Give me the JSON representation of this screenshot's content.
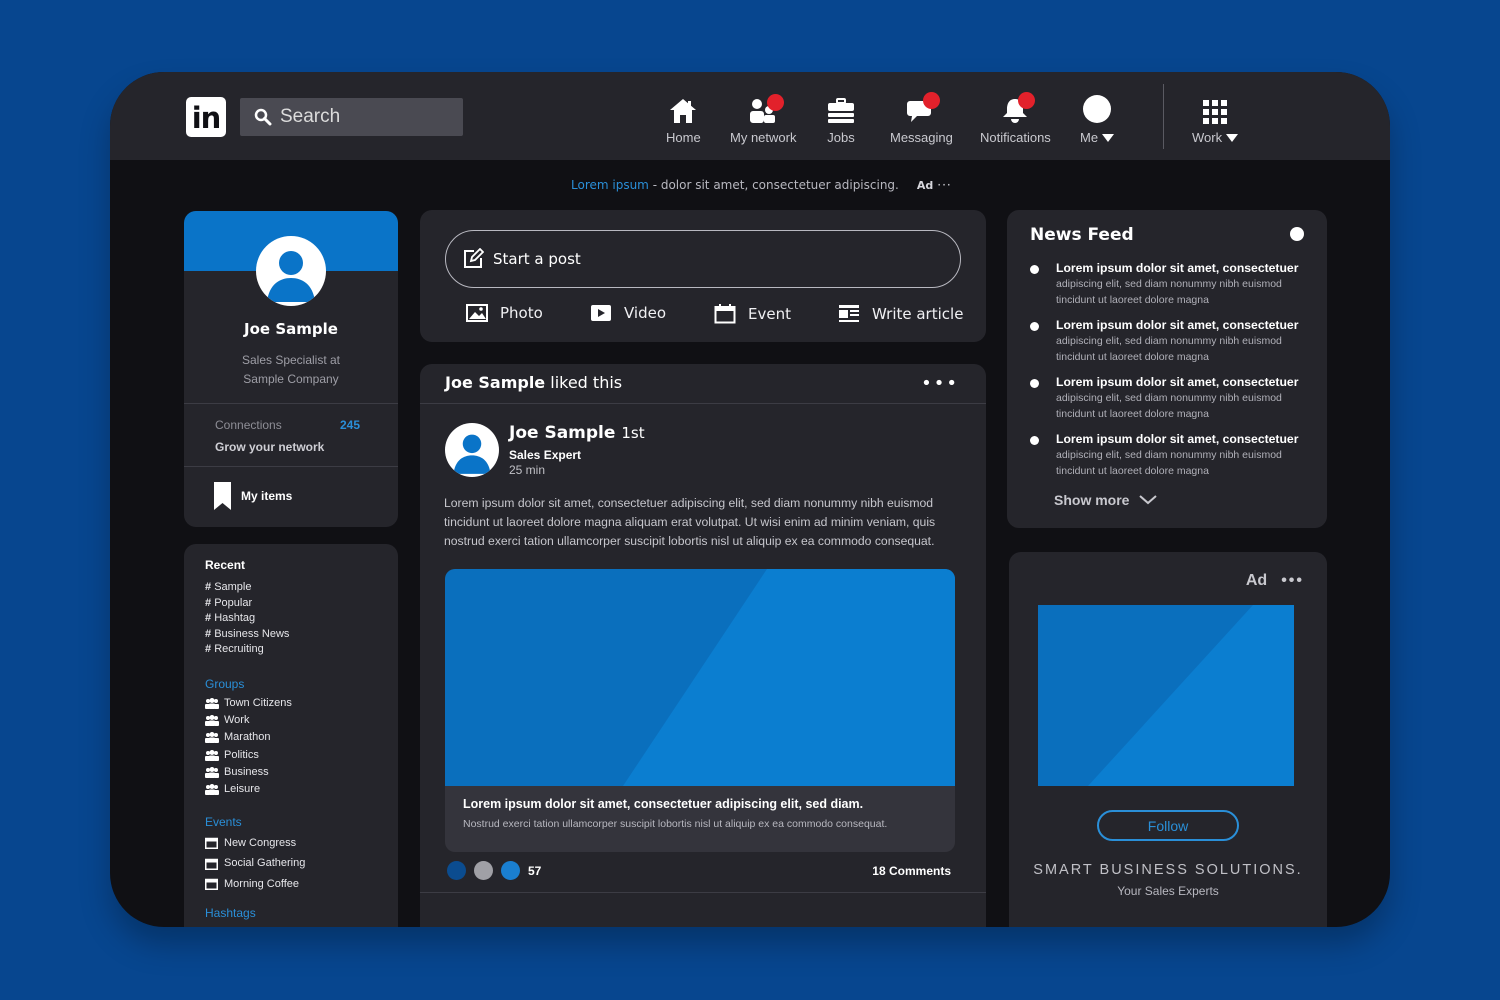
{
  "colors": {
    "accent": "#2a8fd8",
    "brand_blue": "#0a74c8",
    "notification": "#e2212b",
    "background": "#07468f",
    "panel": "#25252b"
  },
  "nav": {
    "logo": "in",
    "search_placeholder": "Search",
    "items": [
      {
        "label": "Home",
        "icon": "home-icon"
      },
      {
        "label": "My network",
        "icon": "network-icon"
      },
      {
        "label": "Jobs",
        "icon": "jobs-icon"
      },
      {
        "label": "Messaging",
        "icon": "messaging-icon"
      },
      {
        "label": "Notifications",
        "icon": "bell-icon"
      },
      {
        "label": "Me",
        "icon": "avatar-icon"
      },
      {
        "label": "Work",
        "icon": "grid-icon"
      }
    ]
  },
  "adbar": {
    "link": "Lorem ipsum",
    "text": " - dolor sit amet, consectetuer adipiscing.",
    "ad": "Ad",
    "more": "···"
  },
  "profile": {
    "name": "Joe Sample",
    "title_line1": "Sales Specialist at",
    "title_line2": "Sample Company",
    "connections_label": "Connections",
    "connections_count": "245",
    "grow": "Grow your network",
    "my_items": "My items"
  },
  "recent": {
    "heading": "Recent",
    "tags": [
      "Sample",
      "Popular",
      "Hashtag",
      "Business News",
      "Recruiting"
    ],
    "groups_heading": "Groups",
    "groups": [
      "Town Citizens",
      "Work",
      "Marathon",
      "Politics",
      "Business",
      "Leisure"
    ],
    "events_heading": "Events",
    "events": [
      "New Congress",
      "Social Gathering",
      "Morning Coffee"
    ],
    "hashtags_heading": "Hashtags"
  },
  "composer": {
    "start": "Start a post",
    "actions": [
      {
        "label": "Photo",
        "icon": "photo-icon"
      },
      {
        "label": "Video",
        "icon": "video-icon"
      },
      {
        "label": "Event",
        "icon": "calendar-icon"
      },
      {
        "label": "Write article",
        "icon": "article-icon"
      }
    ]
  },
  "post": {
    "liked_name": "Joe Sample",
    "liked_text": " liked this",
    "more": "•••",
    "author": "Joe Sample",
    "degree": "1st",
    "role": "Sales Expert",
    "time": "25 min",
    "body": "Lorem ipsum dolor sit amet, consectetuer adipiscing elit, sed diam nonummy nibh euismod tincidunt ut laoreet dolore magna aliquam erat volutpat. Ut wisi enim ad minim veniam, quis nostrud exerci tation ullamcorper suscipit lobortis nisl ut aliquip ex ea commodo consequat.",
    "caption_title": "Lorem ipsum dolor sit amet, consectetuer adipiscing elit, sed diam.",
    "caption_sub": "Nostrud exerci tation ullamcorper suscipit lobortis nisl ut aliquip ex ea commodo consequat.",
    "reactions": "57",
    "reaction_colors": [
      "#0b4c8f",
      "#a0a0a6",
      "#1a7fd0"
    ],
    "comments": "18 Comments"
  },
  "news": {
    "heading": "News Feed",
    "items": [
      {
        "title": "Lorem ipsum dolor sit amet, consectetuer",
        "sub": "adipiscing elit, sed diam nonummy nibh euismod tincidunt ut laoreet dolore magna"
      },
      {
        "title": "Lorem ipsum dolor sit amet, consectetuer",
        "sub": "adipiscing elit, sed diam nonummy nibh euismod tincidunt ut laoreet dolore magna"
      },
      {
        "title": "Lorem ipsum dolor sit amet, consectetuer",
        "sub": "adipiscing elit, sed diam nonummy nibh euismod tincidunt ut laoreet dolore magna"
      },
      {
        "title": "Lorem ipsum dolor sit amet, consectetuer",
        "sub": "adipiscing elit, sed diam nonummy nibh euismod tincidunt ut laoreet dolore magna"
      }
    ],
    "show_more": "Show more"
  },
  "ad_card": {
    "label": "Ad",
    "more": "•••",
    "follow": "Follow",
    "brand": "SMART BUSINESS SOLUTIONS.",
    "slogan": "Your Sales Experts"
  }
}
